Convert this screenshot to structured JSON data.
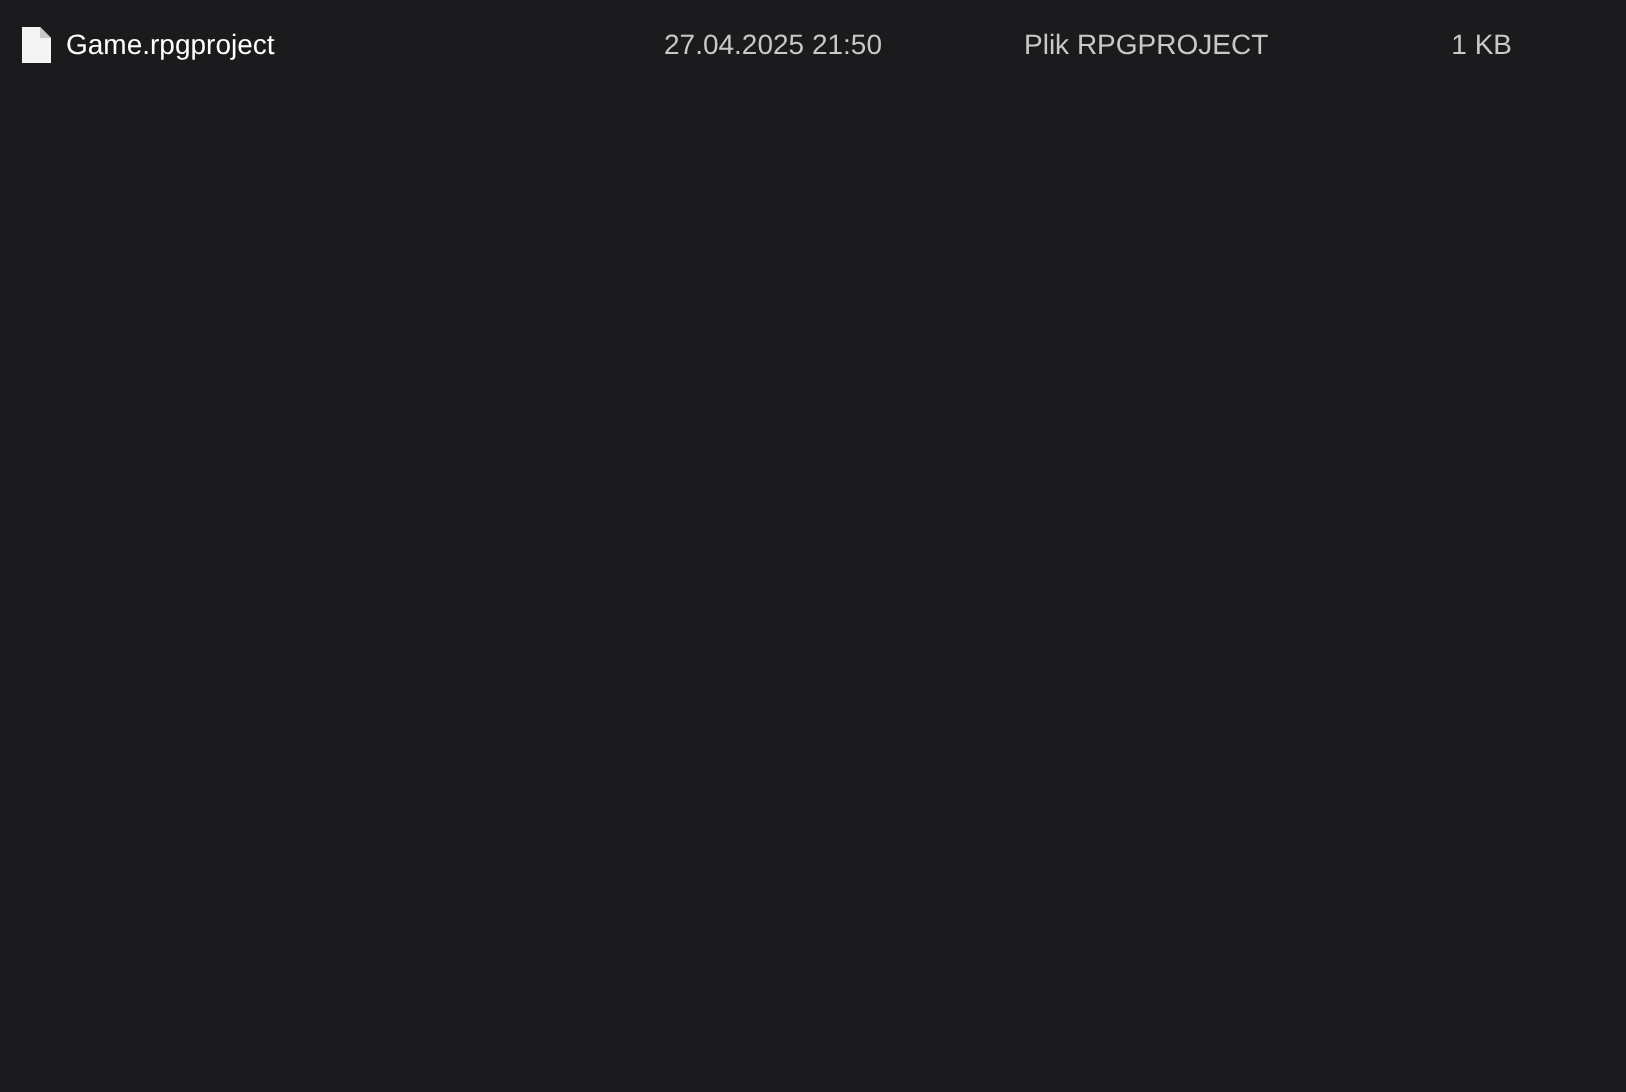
{
  "files": [
    {
      "name": "Game.rpgproject",
      "modified": "27.04.2025 21:50",
      "type": "Plik RPGPROJECT",
      "size": "1 KB",
      "selected": false
    }
  ]
}
